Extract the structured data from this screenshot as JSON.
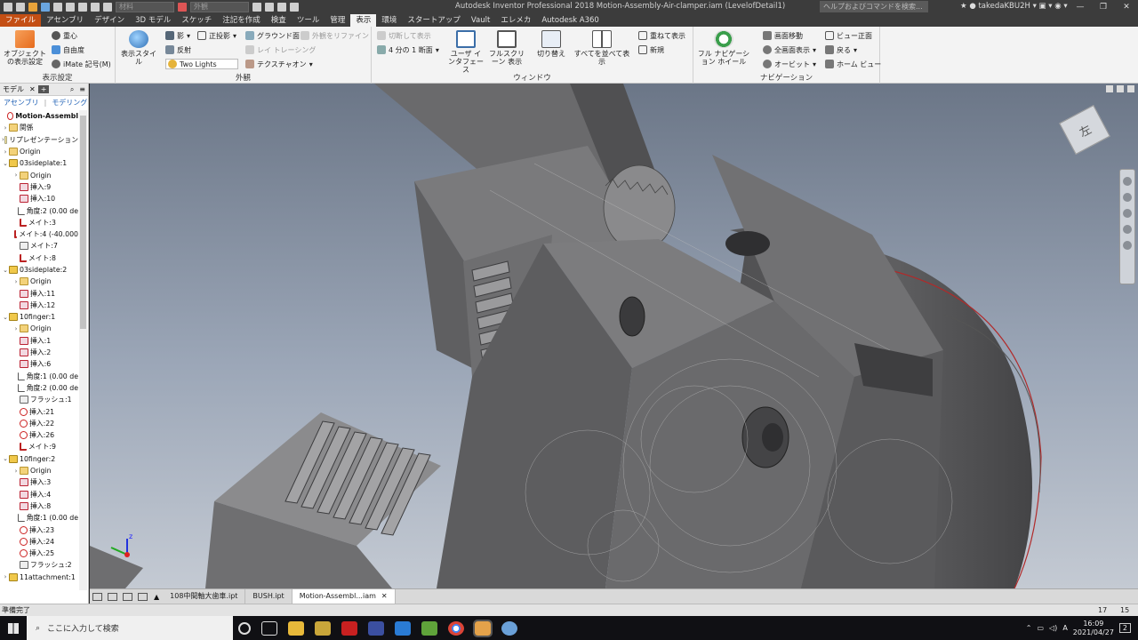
{
  "title_bar": {
    "app_title": "Autodesk Inventor Professional 2018   Motion-Assembly-Air-clamper.iam (LevelofDetail1)",
    "material_combo": "材料",
    "appearance_combo": "外観",
    "help_placeholder": "ヘルプおよびコマンドを検索...",
    "user": "takedaKBU2H"
  },
  "tabs": [
    "ファイル",
    "アセンブリ",
    "デザイン",
    "3D モデル",
    "スケッチ",
    "注記を作成",
    "検査",
    "ツール",
    "管理",
    "表示",
    "環境",
    "スタートアップ",
    "Vault",
    "エレメカ",
    "Autodesk A360"
  ],
  "active_tab": "表示",
  "ribbon": {
    "visibility": {
      "object_visibility": "オブジェクトの表示設定",
      "center_of_gravity": "重心",
      "dof": "自由度",
      "imate": "iMate 記号(M)",
      "panel": "表示設定"
    },
    "appearance": {
      "visual_style": "表示スタイル",
      "shadows": "影",
      "reflections": "反射",
      "lighting": "Two Lights",
      "orthographic": "正投影",
      "ground_plane": "グラウンド面",
      "ray_tracing": "レイ トレーシング",
      "texture": "テクスチャオン",
      "appearance_off": "外観をリファイン",
      "panel": "外観"
    },
    "window": {
      "half_section": "切断して表示",
      "quarter_section": "4 分の 1 断面",
      "user_interface": "ユーザ インタフェース",
      "full_screen": "フルスクリーン 表示",
      "switch": "切り替え",
      "arrange_all": "すべてを並べて表示",
      "cascade": "重ねて表示",
      "new": "新規",
      "panel": "ウィンドウ"
    },
    "navigation": {
      "full_nav_wheel": "フル ナビゲーション ホイール",
      "pan": "画面移動",
      "zoom_all": "全画面表示",
      "orbit": "オービット",
      "look_at": "ビュー正面",
      "back": "戻る",
      "home_view": "ホーム ビュー",
      "panel": "ナビゲーション"
    }
  },
  "browser": {
    "tab_model": "モデル",
    "sub_assembly": "アセンブリ",
    "sub_modeling": "モデリング",
    "tree": [
      {
        "label": "Motion-Assembl",
        "icon": "warn",
        "depth": 0,
        "bold": true,
        "exp": ""
      },
      {
        "label": "関係",
        "icon": "folder",
        "depth": 0,
        "exp": "›"
      },
      {
        "label": "リプレゼンテーション",
        "icon": "rel",
        "depth": 0,
        "exp": "›"
      },
      {
        "label": "Origin",
        "icon": "folder",
        "depth": 0,
        "exp": "›"
      },
      {
        "label": "03sideplate:1",
        "icon": "part",
        "depth": 0,
        "exp": "⌄"
      },
      {
        "label": "Origin",
        "icon": "folder",
        "depth": 1,
        "exp": "›"
      },
      {
        "label": "挿入:9",
        "icon": "insert",
        "depth": 1,
        "exp": ""
      },
      {
        "label": "挿入:10",
        "icon": "insert",
        "depth": 1,
        "exp": ""
      },
      {
        "label": "角度:2 (0.00 de",
        "icon": "angle",
        "depth": 1,
        "exp": ""
      },
      {
        "label": "メイト:3",
        "icon": "mate",
        "depth": 1,
        "exp": ""
      },
      {
        "label": "メイト:4 (-40.000",
        "icon": "mate",
        "depth": 1,
        "exp": ""
      },
      {
        "label": "メイト:7",
        "icon": "flush",
        "depth": 1,
        "exp": ""
      },
      {
        "label": "メイト:8",
        "icon": "mate",
        "depth": 1,
        "exp": ""
      },
      {
        "label": "03sideplate:2",
        "icon": "part",
        "depth": 0,
        "exp": "⌄"
      },
      {
        "label": "Origin",
        "icon": "folder",
        "depth": 1,
        "exp": "›"
      },
      {
        "label": "挿入:11",
        "icon": "insert",
        "depth": 1,
        "exp": ""
      },
      {
        "label": "挿入:12",
        "icon": "insert",
        "depth": 1,
        "exp": ""
      },
      {
        "label": "10finger:1",
        "icon": "part",
        "depth": 0,
        "exp": "⌄"
      },
      {
        "label": "Origin",
        "icon": "folder",
        "depth": 1,
        "exp": "›"
      },
      {
        "label": "挿入:1",
        "icon": "insert",
        "depth": 1,
        "exp": ""
      },
      {
        "label": "挿入:2",
        "icon": "insert",
        "depth": 1,
        "exp": ""
      },
      {
        "label": "挿入:6",
        "icon": "insert",
        "depth": 1,
        "exp": ""
      },
      {
        "label": "角度:1 (0.00 de",
        "icon": "angle",
        "depth": 1,
        "exp": ""
      },
      {
        "label": "角度:2 (0.00 de",
        "icon": "angle",
        "depth": 1,
        "exp": ""
      },
      {
        "label": "フラッシュ:1",
        "icon": "flush",
        "depth": 1,
        "exp": ""
      },
      {
        "label": "挿入:21",
        "icon": "warn",
        "depth": 1,
        "exp": ""
      },
      {
        "label": "挿入:22",
        "icon": "warn",
        "depth": 1,
        "exp": ""
      },
      {
        "label": "挿入:26",
        "icon": "warn",
        "depth": 1,
        "exp": ""
      },
      {
        "label": "メイト:9",
        "icon": "mate",
        "depth": 1,
        "exp": ""
      },
      {
        "label": "10finger:2",
        "icon": "part",
        "depth": 0,
        "exp": "⌄"
      },
      {
        "label": "Origin",
        "icon": "folder",
        "depth": 1,
        "exp": "›"
      },
      {
        "label": "挿入:3",
        "icon": "insert",
        "depth": 1,
        "exp": ""
      },
      {
        "label": "挿入:4",
        "icon": "insert",
        "depth": 1,
        "exp": ""
      },
      {
        "label": "挿入:8",
        "icon": "insert",
        "depth": 1,
        "exp": ""
      },
      {
        "label": "角度:1 (0.00 de",
        "icon": "angle",
        "depth": 1,
        "exp": ""
      },
      {
        "label": "挿入:23",
        "icon": "warn",
        "depth": 1,
        "exp": ""
      },
      {
        "label": "挿入:24",
        "icon": "warn",
        "depth": 1,
        "exp": ""
      },
      {
        "label": "挿入:25",
        "icon": "warn",
        "depth": 1,
        "exp": ""
      },
      {
        "label": "フラッシュ:2",
        "icon": "flush",
        "depth": 1,
        "exp": ""
      },
      {
        "label": "11attachment:1",
        "icon": "part",
        "depth": 0,
        "exp": "›"
      }
    ]
  },
  "viewcube_label": "左",
  "doc_tabs": [
    "108中間軸大歯車.ipt",
    "BUSH.ipt",
    "Motion-Assembl...iam"
  ],
  "active_doc": "Motion-Assembl...iam",
  "status": {
    "text": "準備完了",
    "count1": "17",
    "count2": "15"
  },
  "taskbar": {
    "search_placeholder": "ここに入力して検索",
    "time": "16:09",
    "date": "2021/04/27",
    "ime": "A",
    "notif": "2"
  }
}
